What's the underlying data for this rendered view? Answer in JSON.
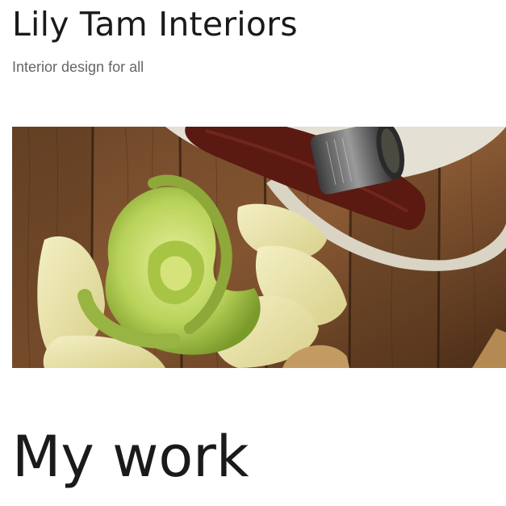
{
  "site": {
    "title": "Lily Tam Interiors",
    "tagline": "Interior design for all"
  },
  "hero": {
    "icon": "food-photo-image",
    "alt": ""
  },
  "main": {
    "heading": "My work"
  },
  "colors": {
    "text": "#1a1a1a",
    "muted_text": "#666666",
    "background": "#ffffff"
  }
}
